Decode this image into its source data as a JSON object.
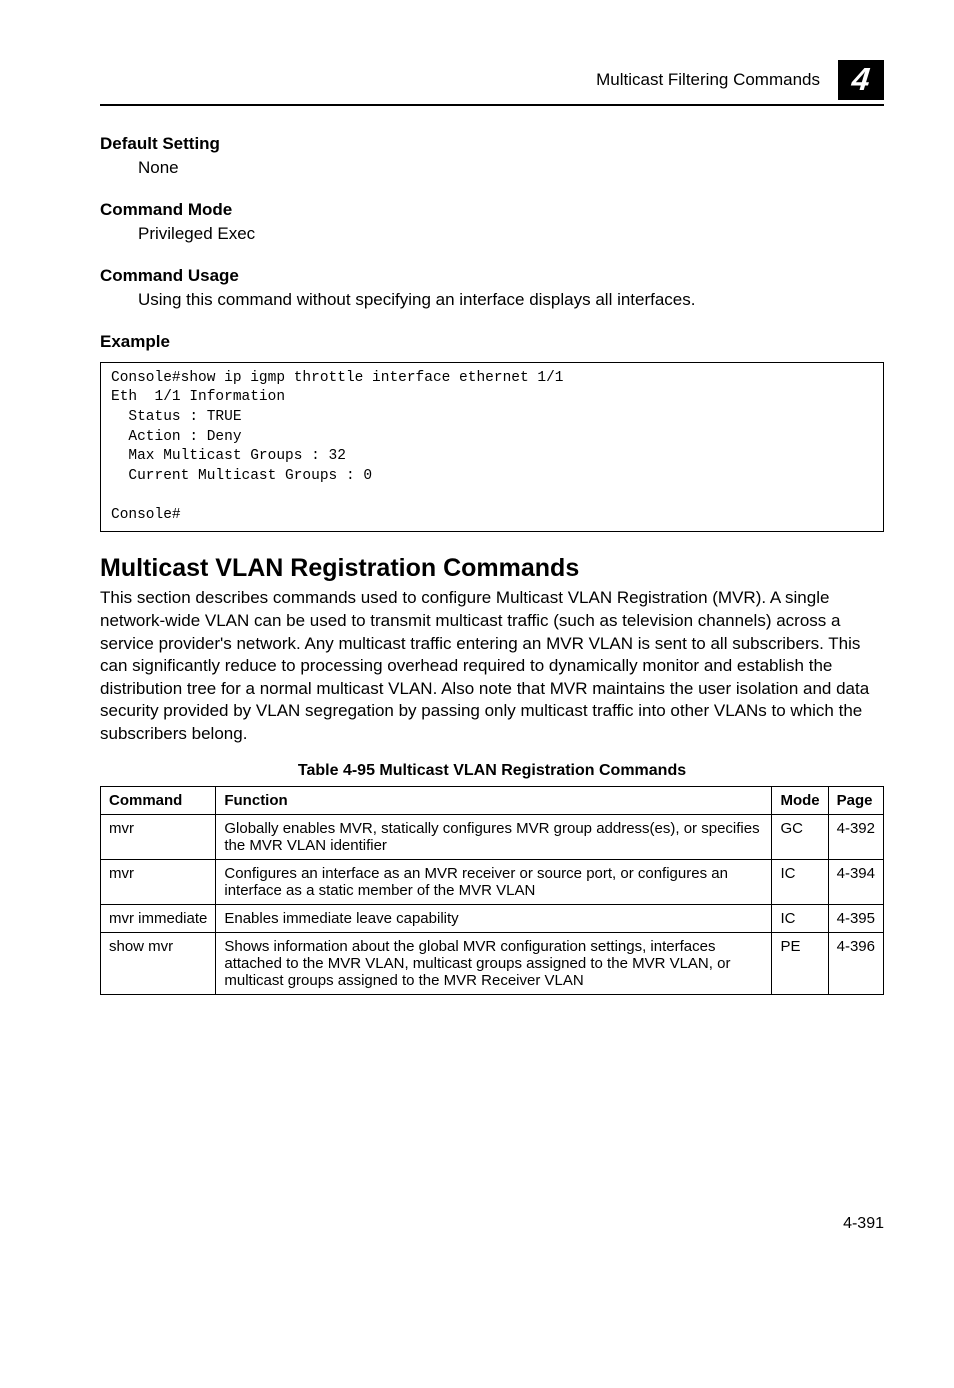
{
  "header": {
    "title": "Multicast Filtering Commands",
    "badge": "4"
  },
  "sections": {
    "defaultSetting": {
      "title": "Default Setting",
      "body": "None"
    },
    "commandMode": {
      "title": "Command Mode",
      "body": "Privileged Exec"
    },
    "commandUsage": {
      "title": "Command Usage",
      "body": "Using this command without specifying an interface displays all interfaces."
    },
    "example": {
      "title": "Example"
    }
  },
  "code": "Console#show ip igmp throttle interface ethernet 1/1\nEth  1/1 Information\n  Status : TRUE\n  Action : Deny\n  Max Multicast Groups : 32\n  Current Multicast Groups : 0\n\nConsole#",
  "h2": "Multicast VLAN Registration Commands",
  "intro": "This section describes commands used to configure Multicast VLAN Registration (MVR). A single network-wide VLAN can be used to transmit multicast traffic (such as television channels) across a service provider's network. Any multicast traffic entering an MVR VLAN is sent to all subscribers. This can significantly reduce to processing overhead required to dynamically monitor and establish the distribution tree for a normal multicast VLAN. Also note that MVR maintains the user isolation and data security provided by VLAN segregation by passing only multicast traffic into other VLANs to which the subscribers belong.",
  "table": {
    "caption": "Table 4-95  Multicast VLAN Registration Commands",
    "headers": {
      "cmd": "Command",
      "func": "Function",
      "mode": "Mode",
      "page": "Page"
    },
    "rows": [
      {
        "cmd": "mvr",
        "func": "Globally enables MVR, statically configures MVR group address(es), or specifies the MVR VLAN identifier",
        "mode": "GC",
        "page": "4-392"
      },
      {
        "cmd": "mvr",
        "func": "Configures an interface as an MVR receiver or source port, or configures an interface as a static member of the MVR VLAN",
        "mode": "IC",
        "page": "4-394"
      },
      {
        "cmd": "mvr immediate",
        "func": "Enables immediate leave capability",
        "mode": "IC",
        "page": "4-395"
      },
      {
        "cmd": "show mvr",
        "func": "Shows information about the global MVR configuration settings, interfaces attached to the MVR VLAN, multicast groups assigned to the MVR VLAN, or multicast groups assigned to the MVR Receiver VLAN",
        "mode": "PE",
        "page": "4-396"
      }
    ]
  },
  "footer": {
    "page": "4-391"
  }
}
